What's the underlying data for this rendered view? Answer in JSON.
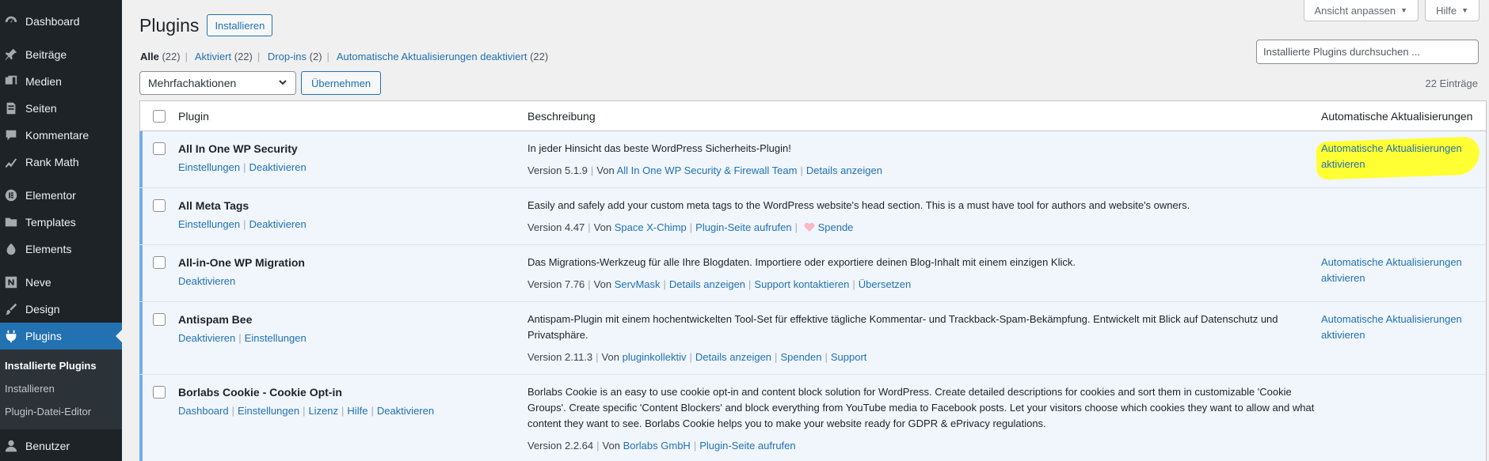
{
  "sidebar": {
    "items": [
      {
        "label": "Dashboard",
        "icon": "dashboard-icon"
      },
      {
        "label": "Beiträge",
        "icon": "pin-icon"
      },
      {
        "label": "Medien",
        "icon": "media-icon"
      },
      {
        "label": "Seiten",
        "icon": "pages-icon"
      },
      {
        "label": "Kommentare",
        "icon": "comment-icon"
      },
      {
        "label": "Rank Math",
        "icon": "rankmath-icon"
      },
      {
        "label": "Elementor",
        "icon": "elementor-icon"
      },
      {
        "label": "Templates",
        "icon": "folder-icon"
      },
      {
        "label": "Elements",
        "icon": "elements-icon"
      },
      {
        "label": "Neve",
        "icon": "neve-icon"
      },
      {
        "label": "Design",
        "icon": "brush-icon"
      },
      {
        "label": "Plugins",
        "icon": "plugin-icon"
      },
      {
        "label": "Benutzer",
        "icon": "user-icon"
      }
    ],
    "submenu": [
      "Installierte Plugins",
      "Installieren",
      "Plugin-Datei-Editor"
    ]
  },
  "screen_options": {
    "ansicht": "Ansicht anpassen",
    "hilfe": "Hilfe"
  },
  "header": {
    "title": "Plugins",
    "add_button": "Installieren"
  },
  "filters": {
    "all": "Alle",
    "all_count": "(22)",
    "active": "Aktiviert",
    "active_count": "(22)",
    "dropins": "Drop-ins",
    "dropins_count": "(2)",
    "auto_off": "Automatische Aktualisierungen deaktiviert",
    "auto_off_count": "(22)"
  },
  "search": {
    "placeholder": "Installierte Plugins durchsuchen ..."
  },
  "bulk": {
    "selected": "Mehrfachaktionen",
    "apply": "Übernehmen"
  },
  "items_count": "22 Einträge",
  "table": {
    "headers": {
      "plugin": "Plugin",
      "description": "Beschreibung",
      "auto": "Automatische Aktualisierungen"
    },
    "rows": [
      {
        "name": "All In One WP Security",
        "actions": [
          "Einstellungen",
          "Deaktivieren"
        ],
        "description": "In jeder Hinsicht das beste WordPress Sicherheits-Plugin!",
        "version": "Version 5.1.9",
        "von": "Von",
        "author": "All In One WP Security & Firewall Team",
        "links": [
          "Details anzeigen"
        ],
        "auto_line1": "Automatische Aktualisierungen",
        "auto_line2": "aktivieren",
        "highlighted": true
      },
      {
        "name": "All Meta Tags",
        "actions": [
          "Einstellungen",
          "Deaktivieren"
        ],
        "description": "Easily and safely add your custom meta tags to the WordPress website's head section. This is a must have tool for authors and website's owners.",
        "version": "Version 4.47",
        "von": "Von",
        "author": "Space X-Chimp",
        "links": [
          "Plugin-Seite aufrufen",
          "Spende"
        ],
        "auto_line1": "",
        "auto_line2": ""
      },
      {
        "name": "All-in-One WP Migration",
        "actions": [
          "Deaktivieren"
        ],
        "description": "Das Migrations-Werkzeug für alle Ihre Blogdaten. Importiere oder exportiere deinen Blog-Inhalt mit einem einzigen Klick.",
        "version": "Version 7.76",
        "von": "Von",
        "author": "ServMask",
        "links": [
          "Details anzeigen",
          "Support kontaktieren",
          "Übersetzen"
        ],
        "auto_line1": "Automatische Aktualisierungen",
        "auto_line2": "aktivieren"
      },
      {
        "name": "Antispam Bee",
        "actions": [
          "Deaktivieren",
          "Einstellungen"
        ],
        "description": "Antispam-Plugin mit einem hochentwickelten Tool-Set für effektive tägliche Kommentar- und Trackback-Spam-Bekämpfung. Entwickelt mit Blick auf Datenschutz und Privatsphäre.",
        "version": "Version 2.11.3",
        "von": "Von",
        "author": "pluginkollektiv",
        "links": [
          "Details anzeigen",
          "Spenden",
          "Support"
        ],
        "auto_line1": "Automatische Aktualisierungen",
        "auto_line2": "aktivieren"
      },
      {
        "name": "Borlabs Cookie - Cookie Opt-in",
        "actions": [
          "Dashboard",
          "Einstellungen",
          "Lizenz",
          "Hilfe",
          "Deaktivieren"
        ],
        "description": "Borlabs Cookie is an easy to use cookie opt-in and content block solution for WordPress. Create detailed descriptions for cookies and sort them in customizable 'Cookie Groups'. Create specific 'Content Blockers' and block everything from YouTube media to Facebook posts. Let your visitors choose which cookies they want to allow and what content they want to see. Borlabs Cookie helps you to make your website ready for GDPR & ePrivacy regulations.",
        "version": "Version 2.2.64",
        "von": "Von",
        "author": "Borlabs GmbH",
        "links": [
          "Plugin-Seite aufrufen"
        ],
        "auto_line1": "",
        "auto_line2": ""
      }
    ]
  }
}
